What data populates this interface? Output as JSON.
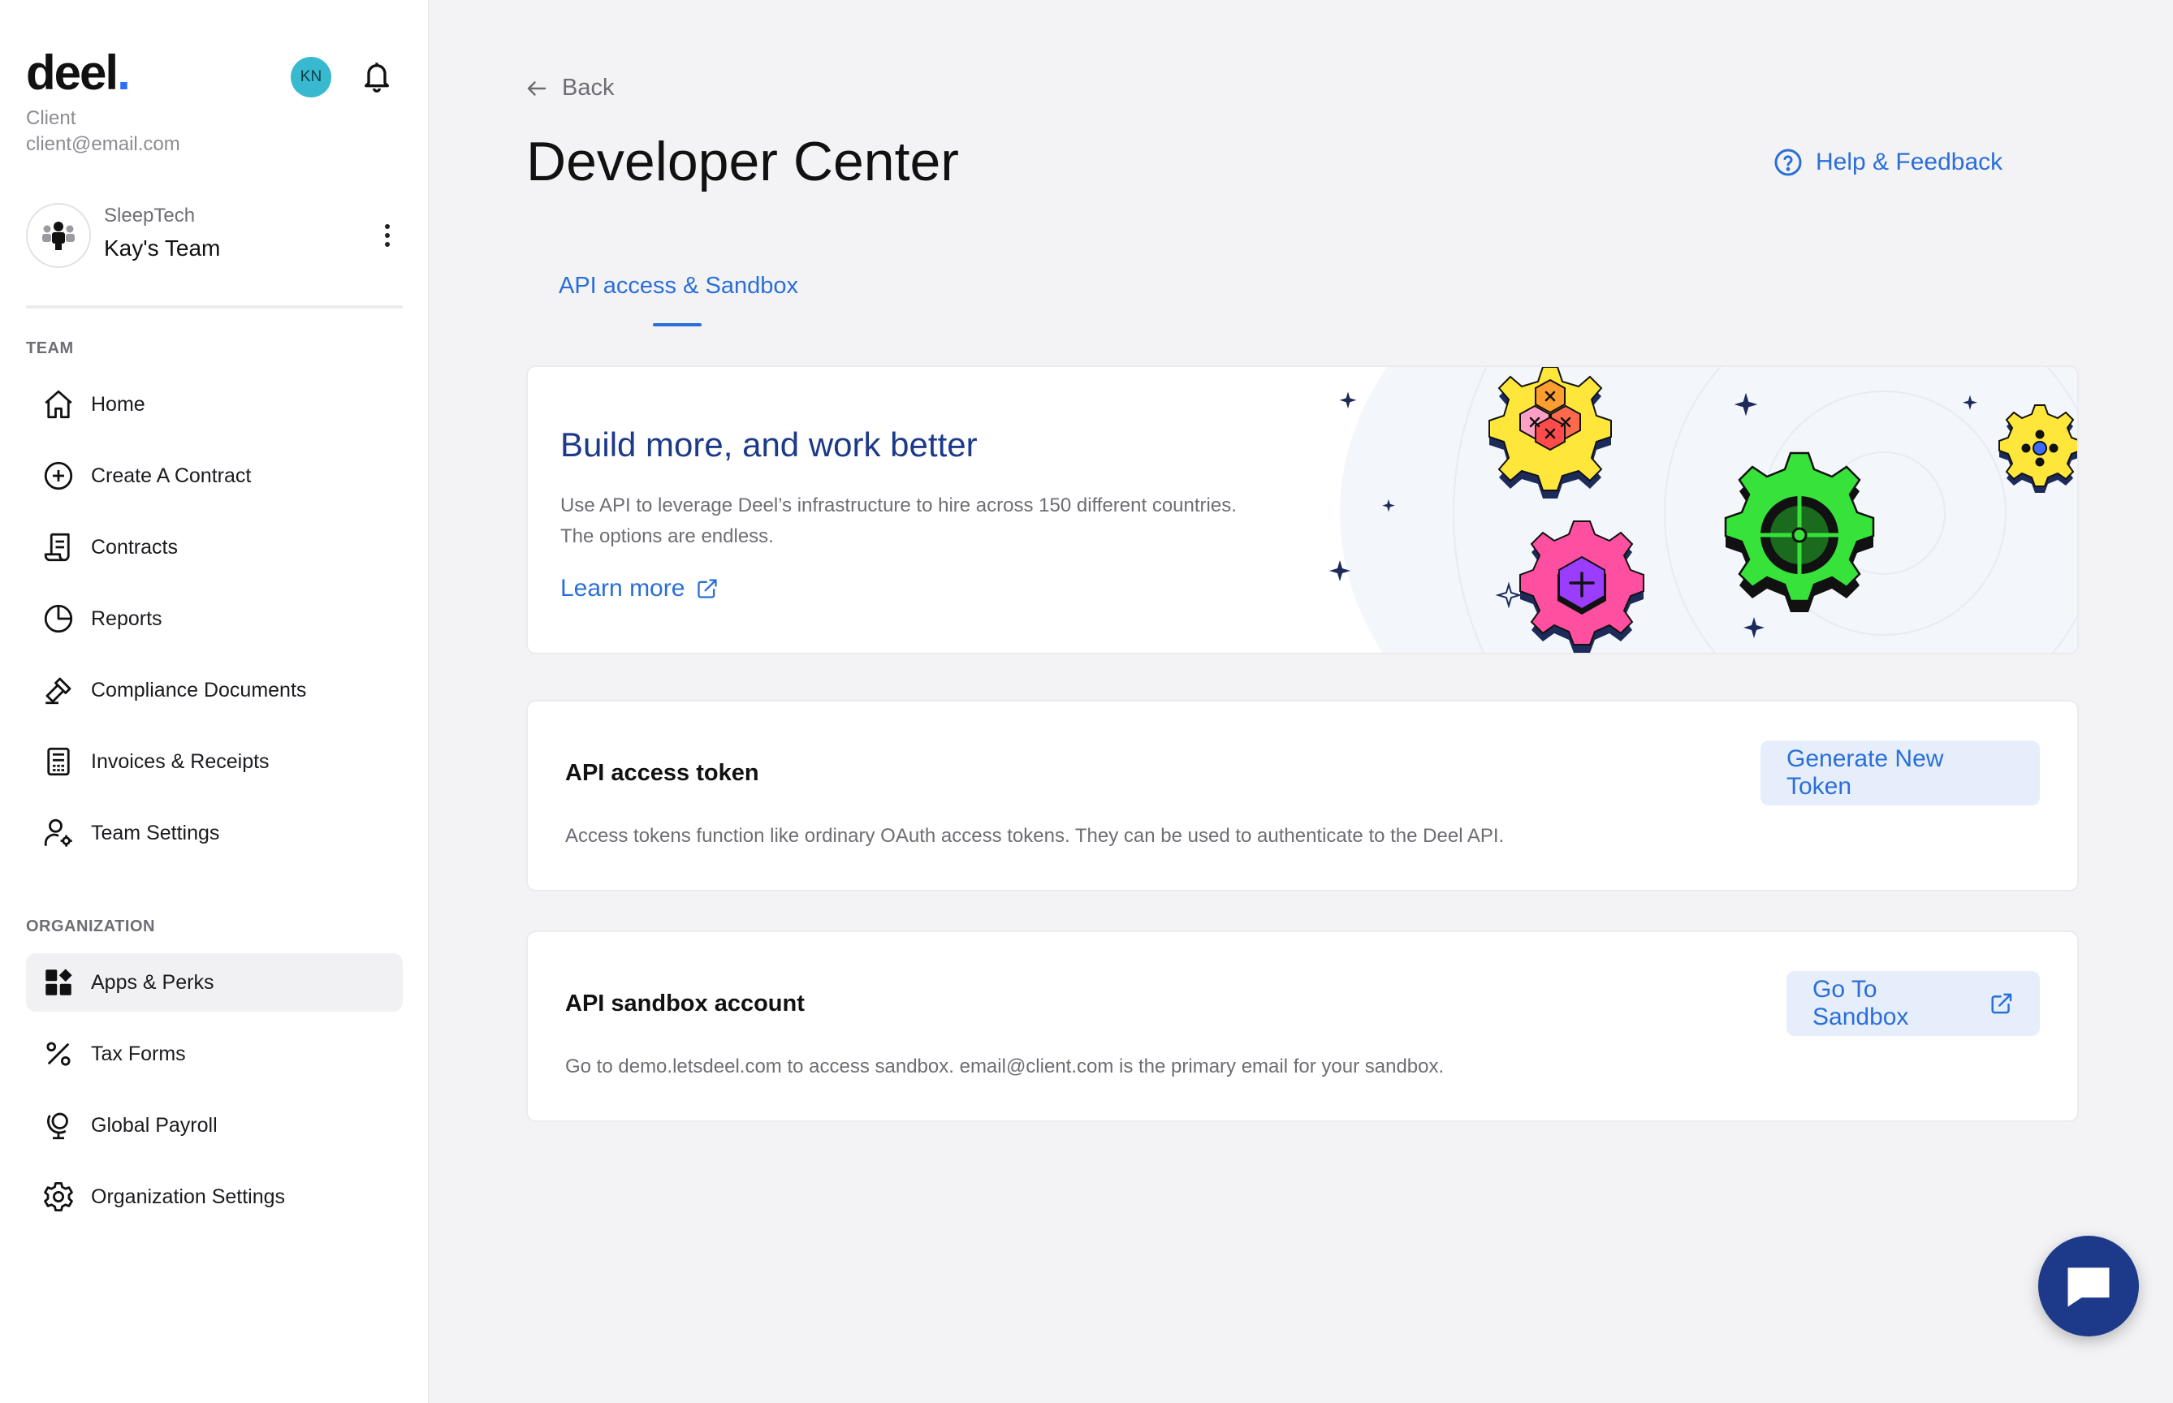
{
  "sidebar": {
    "logo": "deel",
    "logo_dot": ".",
    "user_role": "Client",
    "user_email": "client@email.com",
    "avatar_initials": "KN",
    "team": {
      "company": "SleepTech",
      "name": "Kay's Team"
    },
    "sections": {
      "team_label": "TEAM",
      "org_label": "ORGANIZATION"
    },
    "team_items": [
      {
        "label": "Home",
        "icon": "home-icon"
      },
      {
        "label": "Create A Contract",
        "icon": "plus-circle-icon"
      },
      {
        "label": "Contracts",
        "icon": "contract-scroll-icon"
      },
      {
        "label": "Reports",
        "icon": "pie-chart-icon"
      },
      {
        "label": "Compliance Documents",
        "icon": "gavel-icon"
      },
      {
        "label": "Invoices & Receipts",
        "icon": "receipt-icon"
      },
      {
        "label": "Team Settings",
        "icon": "user-gear-icon"
      }
    ],
    "org_items": [
      {
        "label": "Apps & Perks",
        "icon": "apps-grid-icon",
        "active": true
      },
      {
        "label": "Tax Forms",
        "icon": "percent-icon"
      },
      {
        "label": "Global Payroll",
        "icon": "globe-stand-icon"
      },
      {
        "label": "Organization Settings",
        "icon": "gear-icon"
      }
    ]
  },
  "main": {
    "back_label": "Back",
    "title": "Developer Center",
    "help_label": "Help & Feedback",
    "tabs": [
      {
        "label": "API access & Sandbox",
        "active": true
      }
    ],
    "hero": {
      "title": "Build more, and work better",
      "description_line1": "Use API to leverage Deel’s infrastructure to hire across 150 different countries.",
      "description_line2": "The options are endless.",
      "link_label": "Learn more"
    },
    "token_card": {
      "title": "API access token",
      "description": "Access tokens function like ordinary OAuth access tokens. They can be used to authenticate to the Deel API.",
      "button_label": "Generate New Token"
    },
    "sandbox_card": {
      "title": "API sandbox account",
      "description": "Go to demo.letsdeel.com to access sandbox. email@client.com is the primary email for your sandbox.",
      "button_label": "Go To Sandbox"
    }
  },
  "colors": {
    "accent": "#2a6fd8",
    "hero_title": "#1d3a8a",
    "chat_button": "#1d3a8a",
    "avatar": "#38b9cf",
    "button_bg": "#e6eefb"
  }
}
